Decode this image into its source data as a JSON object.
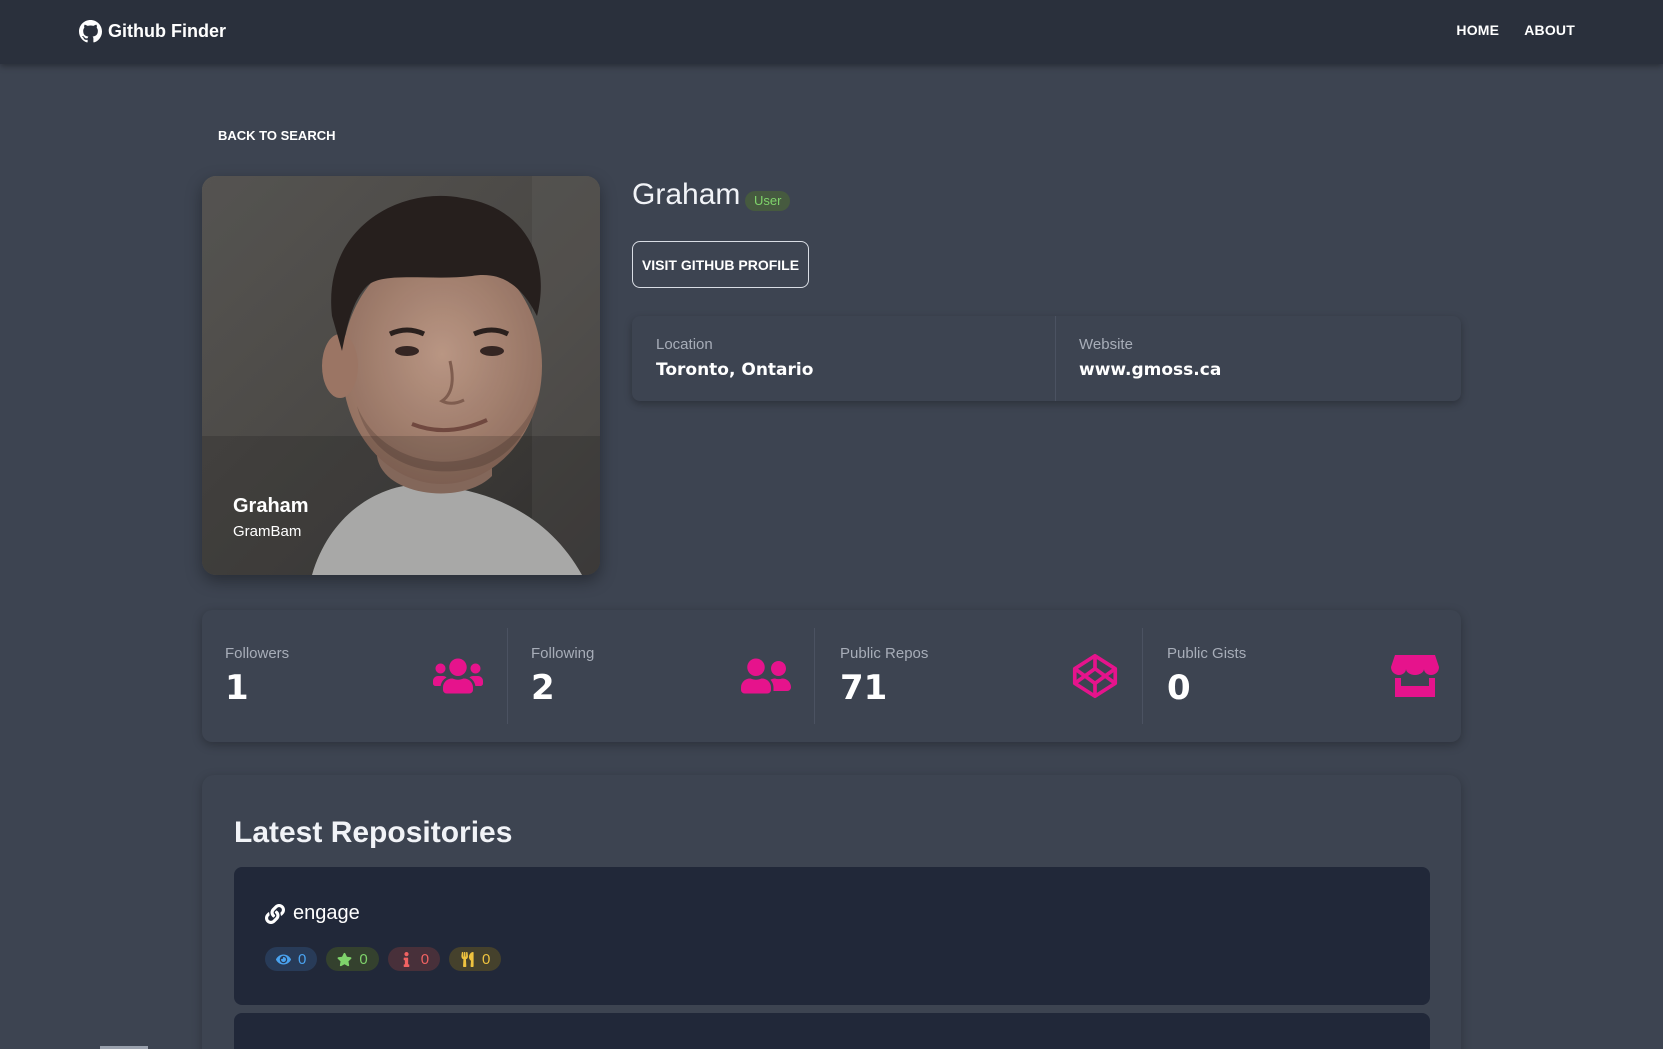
{
  "navbar": {
    "brand": "Github Finder",
    "links": [
      "HOME",
      "ABOUT"
    ]
  },
  "back_button": "BACK TO SEARCH",
  "avatar": {
    "name": "Graham",
    "login": "GramBam"
  },
  "profile": {
    "name": "Graham",
    "type_badge": "User",
    "visit_button": "VISIT GITHUB PROFILE",
    "location_label": "Location",
    "location": "Toronto, Ontario",
    "website_label": "Website",
    "website": "www.gmoss.ca"
  },
  "stats": [
    {
      "label": "Followers",
      "value": "1",
      "icon": "users-icon"
    },
    {
      "label": "Following",
      "value": "2",
      "icon": "user-friends-icon"
    },
    {
      "label": "Public Repos",
      "value": "71",
      "icon": "codepen-icon"
    },
    {
      "label": "Public Gists",
      "value": "0",
      "icon": "store-icon"
    }
  ],
  "repos": {
    "title": "Latest Repositories",
    "items": [
      {
        "name": "engage",
        "watchers": "0",
        "stars": "0",
        "issues": "0",
        "forks": "0"
      }
    ]
  },
  "colors": {
    "background": "#3d4451",
    "navbar": "#2a303c",
    "accent_pink": "#e6138c",
    "repo_card": "#212839"
  }
}
